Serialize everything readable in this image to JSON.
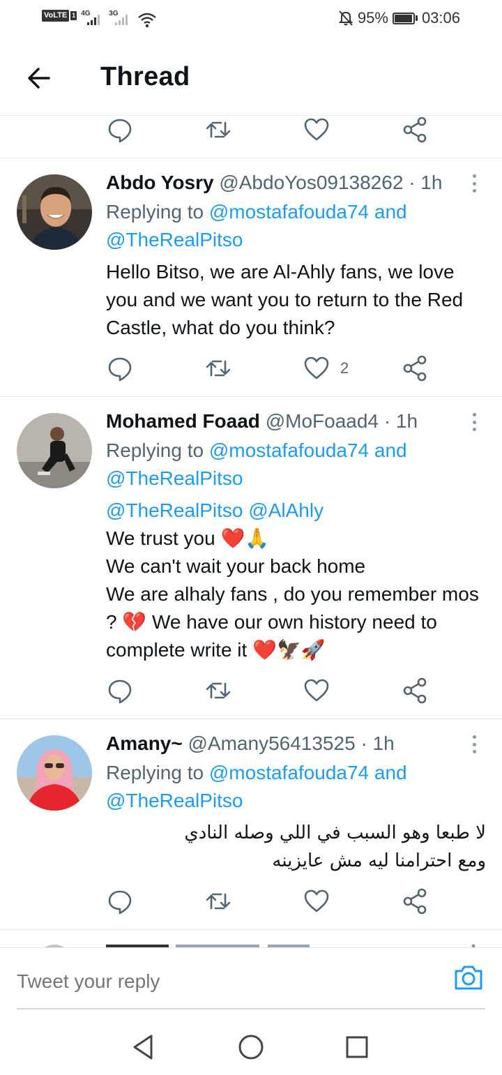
{
  "status_bar": {
    "volte": "VoLTE",
    "sim": "1",
    "net1": "4G",
    "net2": "3G",
    "battery": "95%",
    "battery_level": 0.95,
    "time": "03:06"
  },
  "header": {
    "title": "Thread"
  },
  "tweets": [
    {
      "name": "Abdo Yosry",
      "handle": "@AbdoYos09138262",
      "time": "· 1h",
      "replying_prefix": "Replying to ",
      "replying_user1": "@mostafafouda74",
      "replying_and": " and",
      "replying_user2": "@TheRealPitso",
      "text": "Hello Bitso, we are Al-Ahly fans, we love you and we want you to return to the Red Castle, what do you think?",
      "likes": "2"
    },
    {
      "name": "Mohamed Foaad",
      "handle": "@MoFoaad4",
      "time": "· 1h",
      "replying_prefix": "Replying to ",
      "replying_user1": "@mostafafouda74",
      "replying_and": " and",
      "replying_user2": "@TheRealPitso",
      "mention1": "@TheRealPitso",
      "mention2": "@AlAhly",
      "line1": "We trust you ",
      "line1_emoji": "❤️🙏",
      "line2": "We can't wait your back home",
      "line3a": "We are alhaly fans , do you remember mos ? ",
      "line3_emoji": "💔",
      "line3b": " We have our own history need to complete write it ",
      "line3_end_emoji": "❤️🦅🚀"
    },
    {
      "name": "Amany~",
      "handle": "@Amany56413525",
      "time": "· 1h",
      "replying_prefix": "Replying to ",
      "replying_user1": "@mostafafouda74",
      "replying_and": " and",
      "replying_user2": "@TheRealPitso",
      "text": "لا طبعا وهو السبب في اللي وصله النادي ومع احترامنا ليه مش عايزينه"
    }
  ],
  "compose": {
    "placeholder": "Tweet your reply"
  },
  "colors": {
    "accent": "#1d9bf0",
    "muted": "#536471",
    "text": "#0f1419",
    "divider": "#e1e8ed"
  }
}
